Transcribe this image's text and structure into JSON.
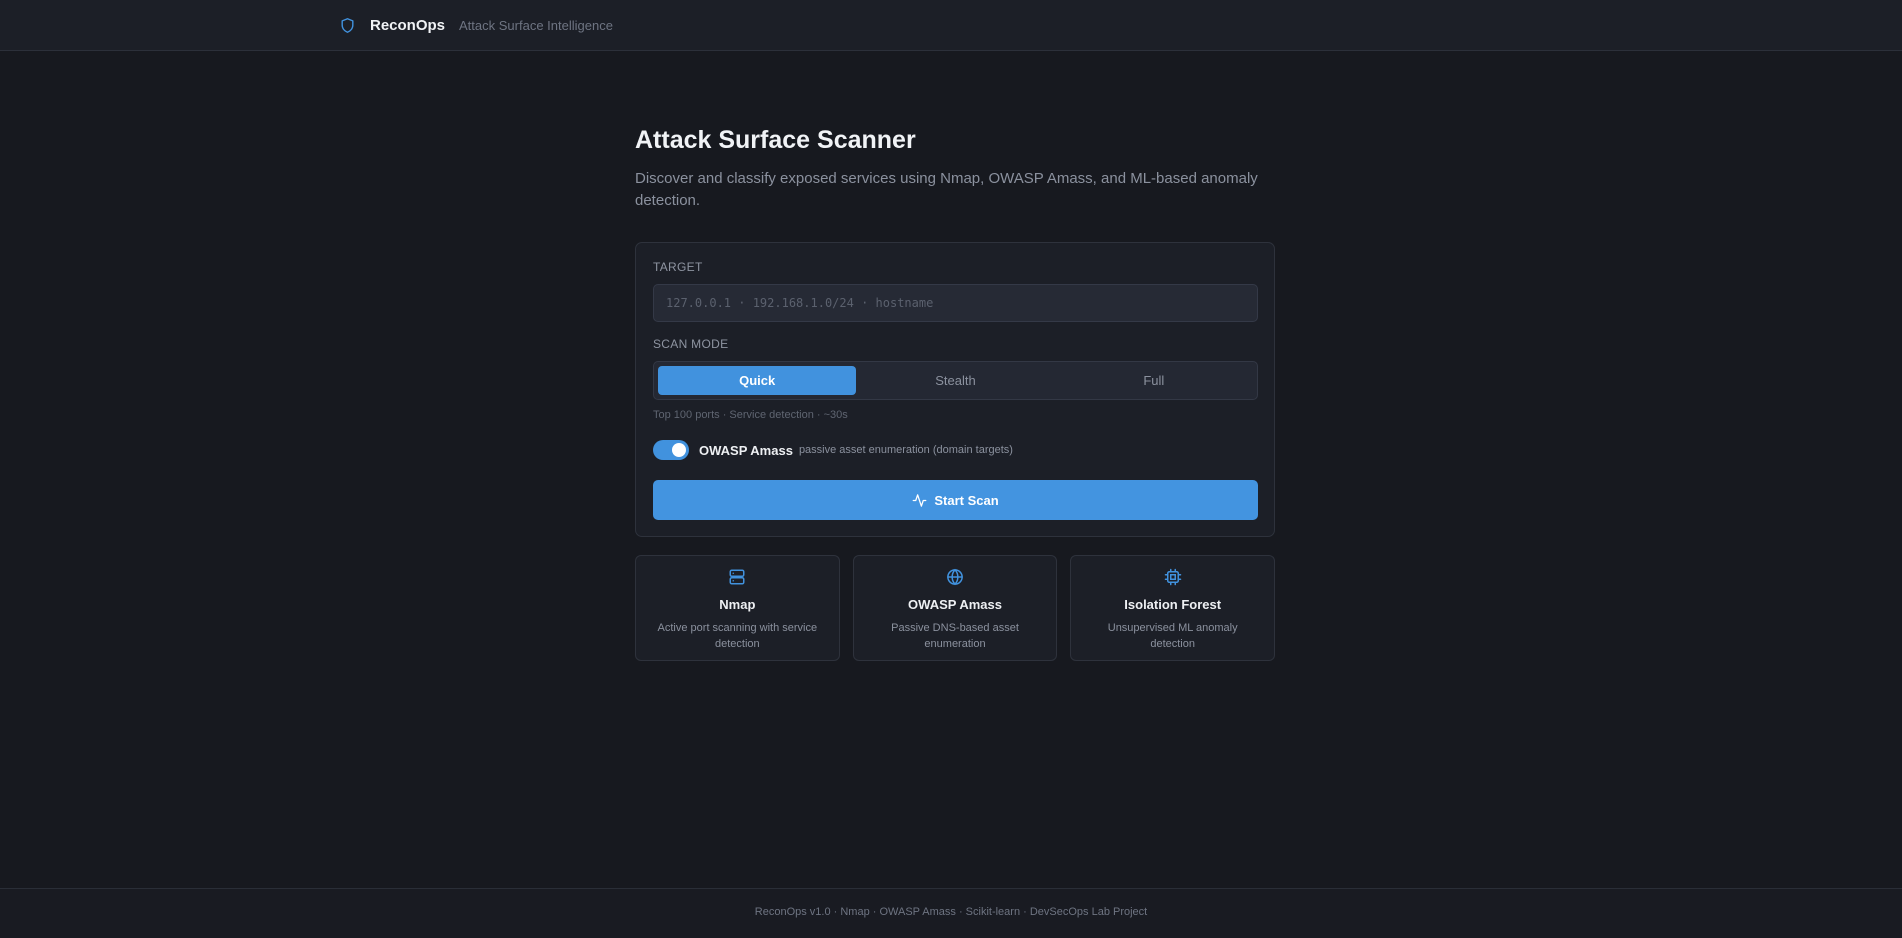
{
  "header": {
    "brand_icon": "shield-icon",
    "brand_name": "ReconOps",
    "tagline": "Attack Surface Intelligence"
  },
  "main": {
    "title": "Attack Surface Scanner",
    "subtitle": "Discover and classify exposed services using Nmap, OWASP Amass, and ML-based anomaly detection."
  },
  "scan_form": {
    "target_label": "TARGET",
    "target_value": "",
    "target_placeholder": "127.0.0.1 · 192.168.1.0/24 · hostname",
    "mode_label": "SCAN MODE",
    "modes": [
      {
        "label": "Quick",
        "selected": true
      },
      {
        "label": "Stealth",
        "selected": false
      },
      {
        "label": "Full",
        "selected": false
      }
    ],
    "mode_hint": "Top 100 ports · Service detection · ~30s",
    "amass_toggle": {
      "enabled": true,
      "label": "OWASP Amass",
      "description": "passive asset enumeration (domain targets)"
    },
    "start_button": {
      "icon": "activity-icon",
      "label": "Start Scan"
    }
  },
  "features": [
    {
      "icon": "server-icon",
      "title": "Nmap",
      "description": "Active port scanning with service detection"
    },
    {
      "icon": "globe-icon",
      "title": "OWASP Amass",
      "description": "Passive DNS-based asset enumeration"
    },
    {
      "icon": "cpu-icon",
      "title": "Isolation Forest",
      "description": "Unsupervised ML anomaly detection"
    }
  ],
  "footer": {
    "text": "ReconOps v1.0 · Nmap · OWASP Amass · Scikit-learn · DevSecOps Lab Project"
  },
  "colors": {
    "accent": "#4192de",
    "background": "#17191f",
    "surface": "#1c1f27",
    "border": "#2e323c",
    "text_primary": "#f1f3f6",
    "text_muted": "#8b919e"
  }
}
